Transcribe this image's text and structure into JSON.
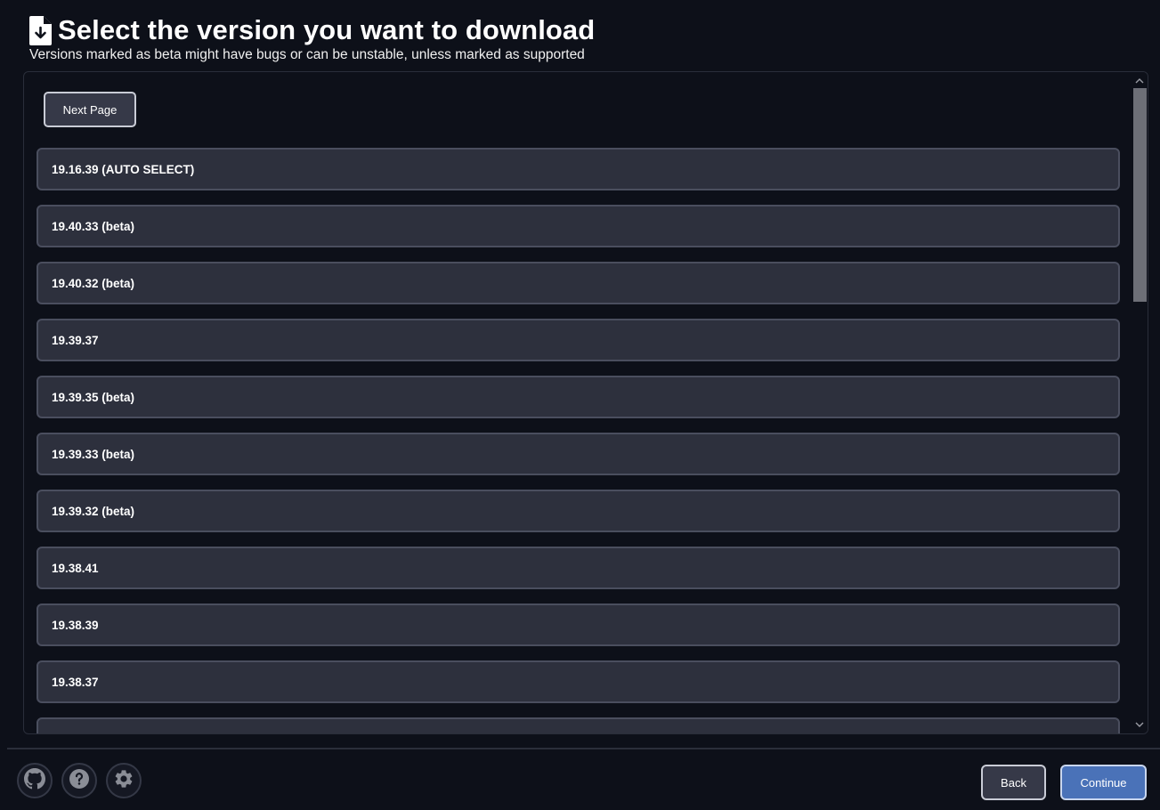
{
  "header": {
    "title": "Select the version you want to download",
    "subtitle": "Versions marked as beta might have bugs or can be unstable, unless marked as supported",
    "icon": "file-download-icon"
  },
  "panel": {
    "next_page_label": "Next Page",
    "versions": [
      "19.16.39 (AUTO SELECT)",
      "19.40.33 (beta)",
      "19.40.32 (beta)",
      "19.39.37",
      "19.39.35 (beta)",
      "19.39.33 (beta)",
      "19.39.32 (beta)",
      "19.38.41",
      "19.38.39",
      "19.38.37",
      ""
    ]
  },
  "footer": {
    "icons": [
      "github-icon",
      "help-icon",
      "settings-icon"
    ],
    "back_label": "Back",
    "continue_label": "Continue"
  },
  "colors": {
    "background": "#0d1019",
    "item_background": "#2d303d",
    "item_border": "#4a4e5e",
    "accent": "#4a72b8"
  }
}
